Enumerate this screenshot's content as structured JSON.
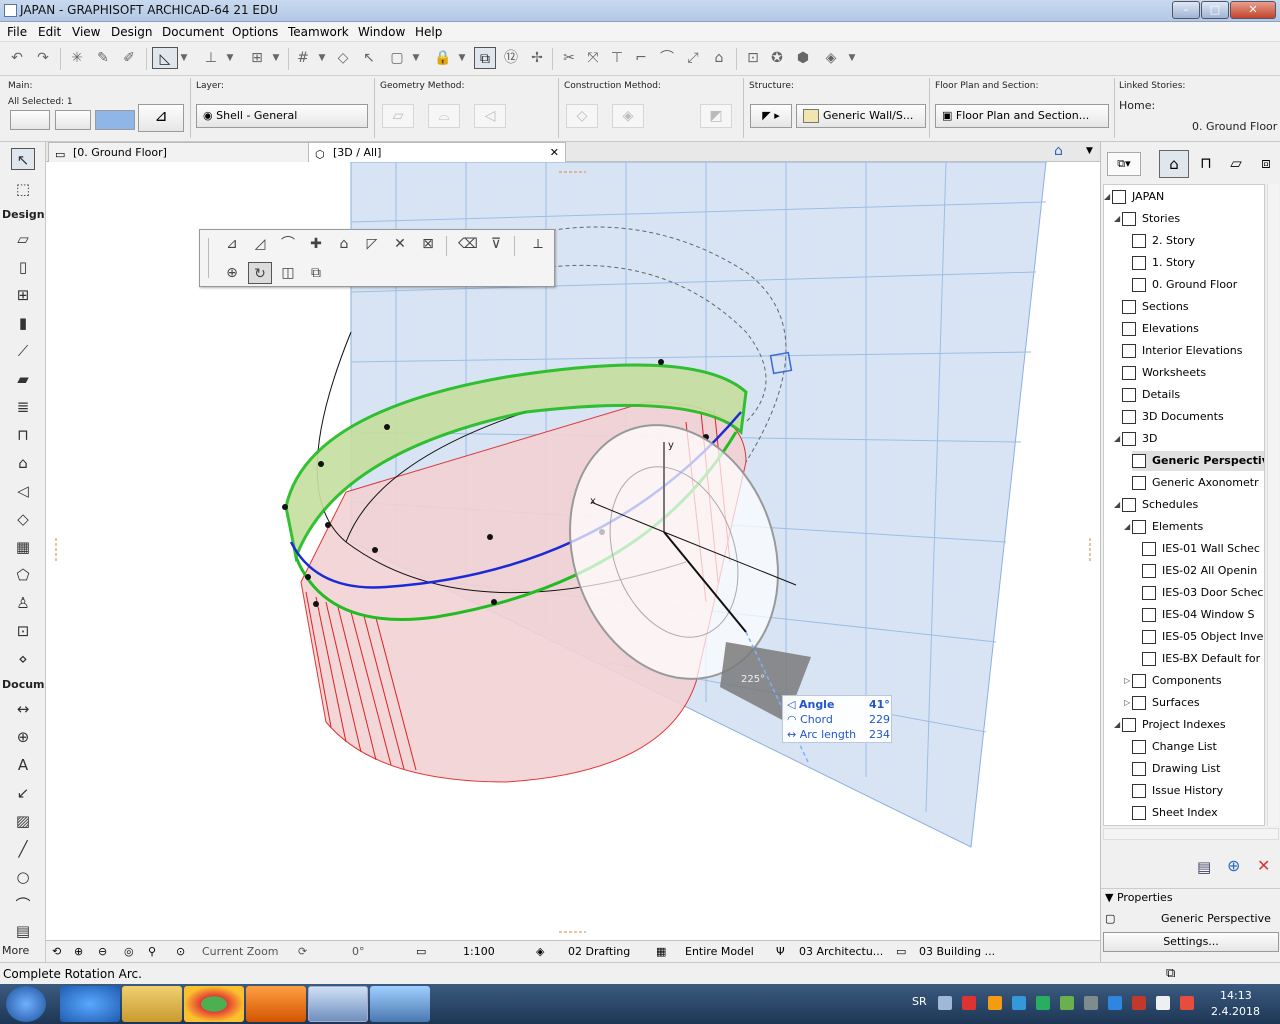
{
  "window": {
    "title": "JAPAN - GRAPHISOFT ARCHICAD-64 21 EDU",
    "min": "–",
    "max": "□",
    "close": "✕"
  },
  "menu": [
    "File",
    "Edit",
    "View",
    "Design",
    "Document",
    "Options",
    "Teamwork",
    "Window",
    "Help"
  ],
  "infobox": {
    "main_label": "Main:",
    "selected": "All Selected: 1",
    "layer_label": "Layer:",
    "layer_value": "Shell - General",
    "geometry_label": "Geometry Method:",
    "construction_label": "Construction Method:",
    "structure_label": "Structure:",
    "structure_value": "Generic Wall/S...",
    "floorplan_label": "Floor Plan and Section:",
    "floorplan_value": "Floor Plan and Section...",
    "linked_label": "Linked Stories:",
    "home_label": "Home:",
    "home_value": "0. Ground Floor"
  },
  "toolbox": {
    "design_label": "Design",
    "document_label": "Docum",
    "more_label": "More"
  },
  "tabs": [
    {
      "label": "[0. Ground Floor]"
    },
    {
      "label": "[3D / All]",
      "close": "✕"
    }
  ],
  "palette_title": "Shell editing palette",
  "tracker": {
    "angle_label": "Angle",
    "angle_value": "41°",
    "chord_label": "Chord",
    "chord_value": "229",
    "arc_label": "Arc length",
    "arc_value": "234",
    "protractor_reading": "225°",
    "axis_x": "x",
    "axis_y": "y"
  },
  "navigator": {
    "items": [
      {
        "label": "JAPAN",
        "level": 0,
        "arrow": "◢"
      },
      {
        "label": "Stories",
        "level": 1,
        "arrow": "◢"
      },
      {
        "label": "2. Story",
        "level": 2
      },
      {
        "label": "1. Story",
        "level": 2
      },
      {
        "label": "0. Ground Floor",
        "level": 2
      },
      {
        "label": "Sections",
        "level": 1
      },
      {
        "label": "Elevations",
        "level": 1
      },
      {
        "label": "Interior Elevations",
        "level": 1
      },
      {
        "label": "Worksheets",
        "level": 1
      },
      {
        "label": "Details",
        "level": 1
      },
      {
        "label": "3D Documents",
        "level": 1
      },
      {
        "label": "3D",
        "level": 1,
        "arrow": "◢"
      },
      {
        "label": "Generic Perspective",
        "level": 2,
        "selected": true
      },
      {
        "label": "Generic Axonometr",
        "level": 2
      },
      {
        "label": "Schedules",
        "level": 1,
        "arrow": "◢"
      },
      {
        "label": "Elements",
        "level": 2,
        "arrow": "◢"
      },
      {
        "label": "IES-01 Wall Schec",
        "level": 3
      },
      {
        "label": "IES-02 All Openin",
        "level": 3
      },
      {
        "label": "IES-03 Door Schec",
        "level": 3
      },
      {
        "label": "IES-04 Window S",
        "level": 3
      },
      {
        "label": "IES-05 Object Inve",
        "level": 3
      },
      {
        "label": "IES-BX Default for",
        "level": 3
      },
      {
        "label": "Components",
        "level": 2,
        "arrow": "▷"
      },
      {
        "label": "Surfaces",
        "level": 2,
        "arrow": "▷"
      },
      {
        "label": "Project Indexes",
        "level": 1,
        "arrow": "◢"
      },
      {
        "label": "Change List",
        "level": 2
      },
      {
        "label": "Drawing List",
        "level": 2
      },
      {
        "label": "Issue History",
        "level": 2
      },
      {
        "label": "Sheet Index",
        "level": 2
      }
    ],
    "properties_label": "Properties",
    "properties_value": "Generic Perspective",
    "settings_button": "Settings..."
  },
  "statusbar": {
    "zoom": "Current Zoom",
    "angle": "0°",
    "scale": "1:100",
    "layer_combo": "02 Drafting",
    "model": "Entire Model",
    "pen_set": "03 Architectu...",
    "dim": "03 Building ..."
  },
  "hint": "Complete Rotation Arc.",
  "taskbar": {
    "lang": "SR",
    "time": "14:13",
    "date": "2.4.2018"
  }
}
